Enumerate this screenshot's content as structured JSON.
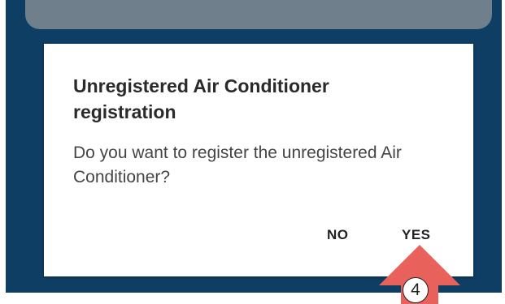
{
  "dialog": {
    "title": "Unregistered Air Conditioner registration",
    "message": "Do you want to register the unregistered Air Conditioner?",
    "no_label": "NO",
    "yes_label": "YES"
  },
  "callout": {
    "step_number": "4",
    "arrow_color": "#e8615a",
    "icon": "up-arrow-icon"
  },
  "colors": {
    "background": "#0e3e63",
    "dialog": "#ffffff",
    "card": "#6f7f8b"
  }
}
